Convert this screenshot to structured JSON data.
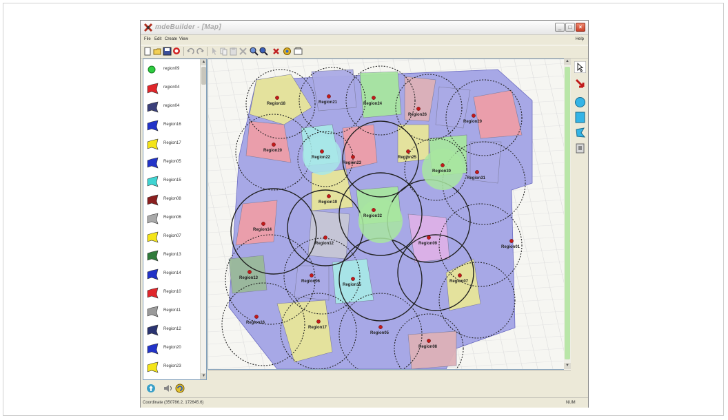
{
  "window": {
    "title": "mdeBuilder - [Map]",
    "minimize_glyph": "_",
    "maximize_glyph": "□",
    "close_glyph": "×"
  },
  "menu": {
    "items": [
      "File",
      "Edit",
      "Create",
      "View"
    ],
    "help": "Help"
  },
  "toolbar": {
    "icons": [
      "new-icon",
      "open-icon",
      "save-icon",
      "find-icon",
      "undo-icon",
      "redo-icon",
      "pointer-icon",
      "copy-icon",
      "paste-icon",
      "delete-icon",
      "zoom-in-icon",
      "zoom-out-icon",
      "stop-icon",
      "tool-icon",
      "export-icon"
    ]
  },
  "layers": [
    {
      "label": "region09",
      "color": "#2ecc40"
    },
    {
      "label": "region04",
      "color": "#e0262b"
    },
    {
      "label": "region04",
      "color": "#3a3f7a"
    },
    {
      "label": "Region16",
      "color": "#2233c8"
    },
    {
      "label": "Region17",
      "color": "#f4e418"
    },
    {
      "label": "Region05",
      "color": "#2233c8"
    },
    {
      "label": "Region15",
      "color": "#3fd4d2"
    },
    {
      "label": "Region08",
      "color": "#8a1f1f"
    },
    {
      "label": "Region06",
      "color": "#a9a9a9"
    },
    {
      "label": "Region07",
      "color": "#f4e418"
    },
    {
      "label": "Region13",
      "color": "#2f7a3a"
    },
    {
      "label": "Region14",
      "color": "#2233c8"
    },
    {
      "label": "Region10",
      "color": "#e0262b"
    },
    {
      "label": "Region11",
      "color": "#9a9a9a"
    },
    {
      "label": "Region12",
      "color": "#2a3370"
    },
    {
      "label": "Region20",
      "color": "#2233c8"
    },
    {
      "label": "Region23",
      "color": "#f4e418"
    }
  ],
  "map_regions": [
    {
      "name": "Region18",
      "color": "#e8e69a"
    },
    {
      "name": "Region21",
      "color": "#ababe6"
    },
    {
      "name": "Region24",
      "color": "#a8e6a0"
    },
    {
      "name": "Region26",
      "color": "#ddb1b8"
    },
    {
      "name": "Region27",
      "color": "#ababe6"
    },
    {
      "name": "Region20",
      "color": "#ee9ea8"
    },
    {
      "name": "Region22",
      "color": "#a8e8e8"
    },
    {
      "name": "Region23",
      "color": "#ee9ea8"
    },
    {
      "name": "Region25",
      "color": "#e8e69a"
    },
    {
      "name": "Region30",
      "color": "#a8e6a0"
    },
    {
      "name": "Region31",
      "color": "#ababe6"
    },
    {
      "name": "Region29",
      "color": "#ababe6"
    },
    {
      "name": "Region19",
      "color": "#e8e69a"
    },
    {
      "name": "Region32",
      "color": "#a8e6a0"
    },
    {
      "name": "Region14",
      "color": "#ee9ea8"
    },
    {
      "name": "Region12",
      "color": "#c7c7d6"
    },
    {
      "name": "Region09",
      "color": "#ddb1e8"
    },
    {
      "name": "Region13",
      "color": "#9ab99a"
    },
    {
      "name": "Region15",
      "color": "#a8e8e8"
    },
    {
      "name": "Region06",
      "color": "#ababe6"
    },
    {
      "name": "Region07",
      "color": "#e8e69a"
    },
    {
      "name": "Region16",
      "color": "#ababe6"
    },
    {
      "name": "Region17",
      "color": "#e8e69a"
    },
    {
      "name": "Region05",
      "color": "#ababe6"
    },
    {
      "name": "Region08",
      "color": "#ddb1b8"
    },
    {
      "name": "Region01",
      "color": "#ababe6"
    }
  ],
  "status": {
    "coordinate": "Coordinate (350786.2, 172645.6)",
    "mode": "NUM"
  },
  "right_tools": [
    "pointer-tool-icon",
    "red-arrow-tool-icon",
    "circle-tool-icon",
    "rectangle-tool-icon",
    "polygon-tool-icon",
    "stamp-tool-icon"
  ]
}
